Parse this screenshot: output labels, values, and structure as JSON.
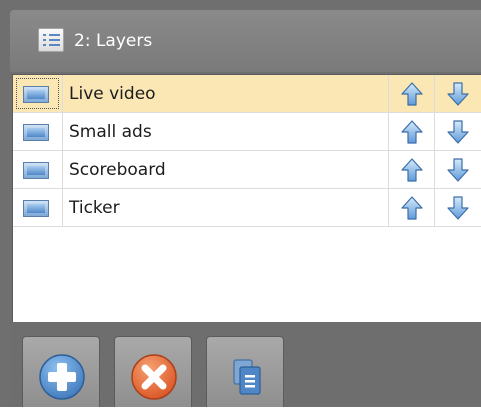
{
  "panel": {
    "title": "2: Layers",
    "header_icon": "list-icon"
  },
  "layers": [
    {
      "name": "Live video",
      "icon": "image-icon",
      "selected": true
    },
    {
      "name": "Small ads",
      "icon": "image-icon",
      "selected": false
    },
    {
      "name": "Scoreboard",
      "icon": "image-icon",
      "selected": false
    },
    {
      "name": "Ticker",
      "icon": "image-icon",
      "selected": false
    }
  ],
  "row_actions": {
    "up_icon": "arrow-up-icon",
    "down_icon": "arrow-down-icon"
  },
  "toolbar": {
    "buttons": [
      {
        "icon": "add-icon",
        "color": "#4a86c8"
      },
      {
        "icon": "remove-icon",
        "color": "#e2622f"
      },
      {
        "icon": "duplicate-icon",
        "color": "#4f86c6"
      }
    ]
  },
  "colors": {
    "selected_row": "#fbe7b4",
    "panel_bg": "#6f6f6f",
    "arrow_fill": "#6fa8e0"
  }
}
